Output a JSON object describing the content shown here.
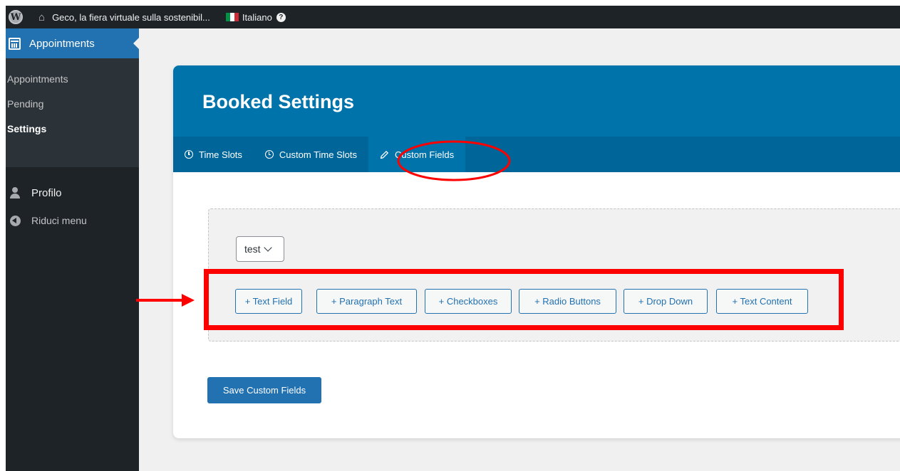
{
  "adminbar": {
    "wp_logo": "W",
    "home_icon": "home-icon",
    "site_name": "Geco, la fiera virtuale sulla sostenibil...",
    "language": "Italiano",
    "help_glyph": "?"
  },
  "sidebar": {
    "top_item": "Appointments",
    "submenu": [
      "Appointments",
      "Pending",
      "Settings"
    ],
    "current_submenu": "Settings",
    "items": [
      {
        "label": "Profilo",
        "icon": "user-icon"
      },
      {
        "label": "Riduci menu",
        "icon": "collapse-icon"
      }
    ]
  },
  "card": {
    "title": "Booked Settings",
    "tabs": [
      {
        "label": "Time Slots",
        "icon": "clock-icon",
        "active": false
      },
      {
        "label": "Custom Time Slots",
        "icon": "clock-icon",
        "active": false
      },
      {
        "label": "Custom Fields",
        "icon": "pencil-icon",
        "active": true
      }
    ],
    "select_value": "test",
    "field_buttons": [
      "+ Text Field",
      "+ Paragraph Text",
      "+ Checkboxes",
      "+ Radio Buttons",
      "+ Drop Down",
      "+ Text Content"
    ],
    "save_label": "Save Custom Fields"
  },
  "colors": {
    "admin_dark": "#1d2327",
    "accent": "#2271b1",
    "header_blue": "#0073aa",
    "tabs_blue": "#00669a",
    "annotation_red": "#ff0000"
  }
}
